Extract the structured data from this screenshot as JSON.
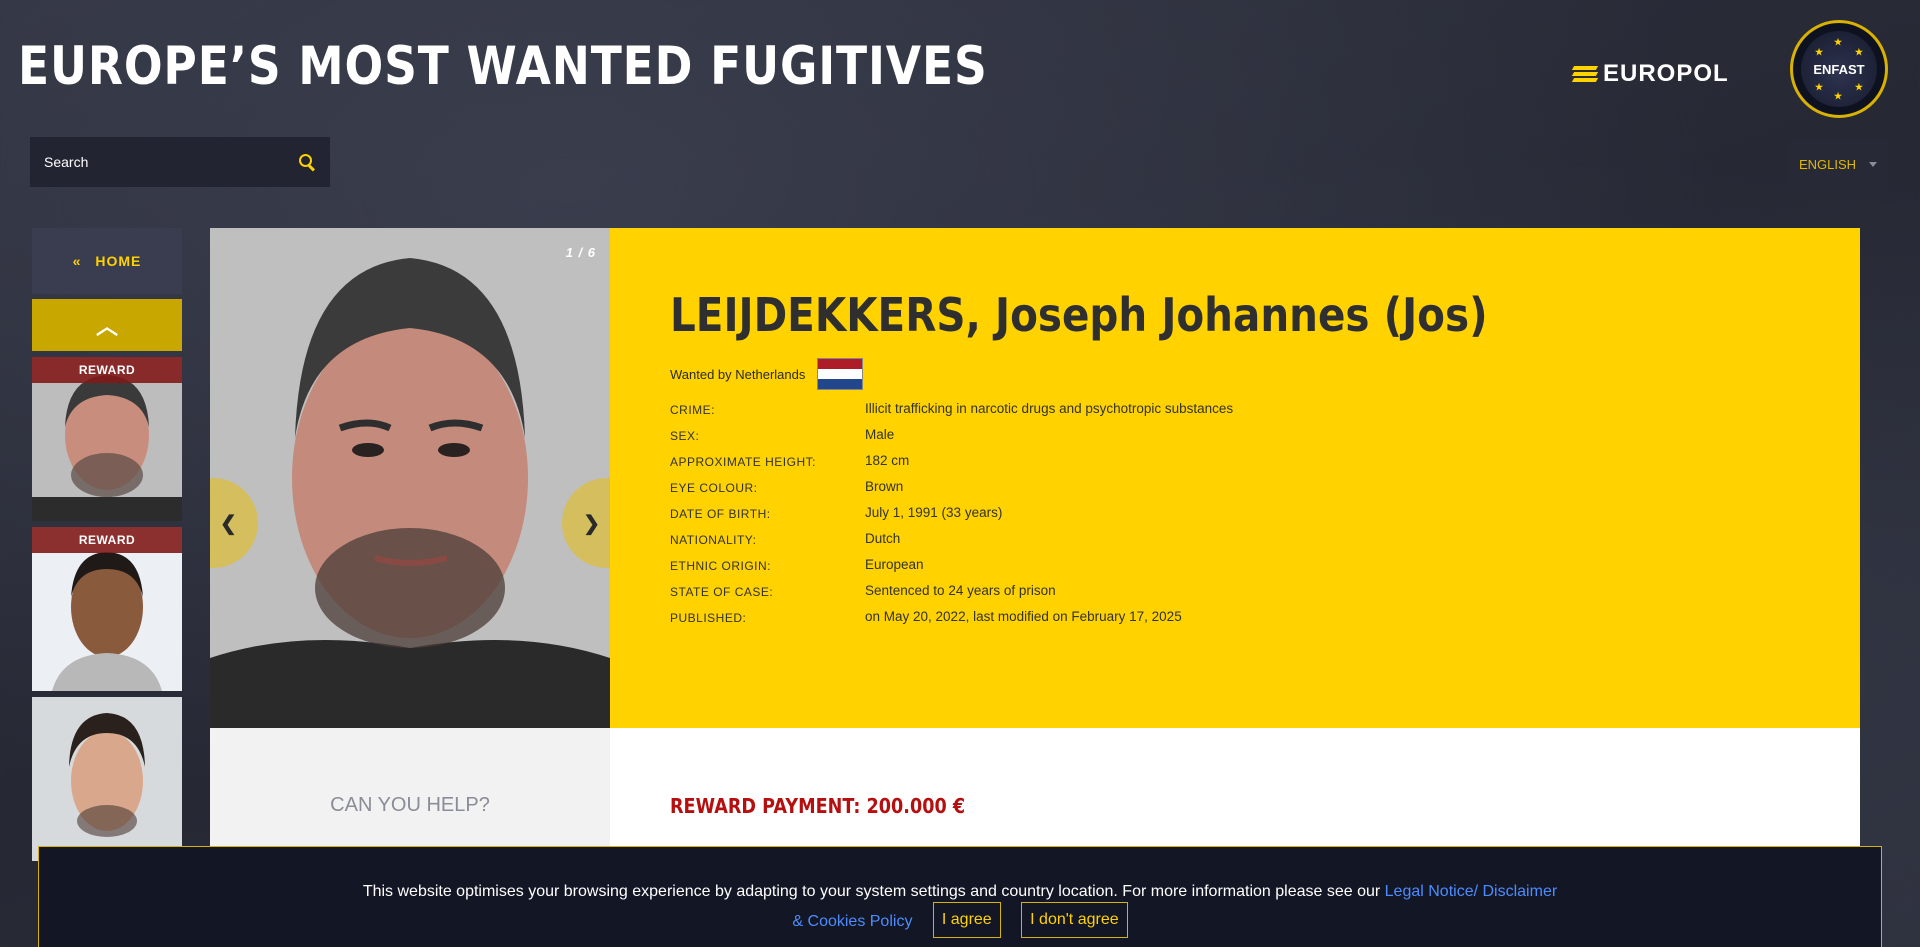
{
  "header": {
    "title": "EUROPE’S MOST WANTED FUGITIVES",
    "europol_logo_text": "EUROPOL",
    "enfast_logo_text": "ENFAST"
  },
  "search": {
    "placeholder": "Search"
  },
  "language": {
    "selected": "ENGLISH"
  },
  "sidebar": {
    "home_label": "HOME",
    "home_icon": "«",
    "up_icon": "︿",
    "thumbs": [
      {
        "tag": "REWARD"
      },
      {
        "tag": "REWARD"
      },
      {
        "tag": ""
      }
    ]
  },
  "gallery": {
    "counter": "1 / 6",
    "prev_icon": "❮",
    "next_icon": "❯"
  },
  "fugitive": {
    "name": "LEIJDEKKERS, Joseph Johannes (Jos)",
    "wanted_by": "Wanted by Netherlands",
    "details": [
      {
        "label": "CRIME:",
        "value": "Illicit trafficking in narcotic drugs and psychotropic substances"
      },
      {
        "label": "SEX:",
        "value": "Male"
      },
      {
        "label": "APPROXIMATE HEIGHT:",
        "value": "182 cm"
      },
      {
        "label": "EYE COLOUR:",
        "value": "Brown"
      },
      {
        "label": "DATE OF BIRTH:",
        "value": "July 1, 1991 (33 years)"
      },
      {
        "label": "NATIONALITY:",
        "value": "Dutch"
      },
      {
        "label": "ETHNIC ORIGIN:",
        "value": "European"
      },
      {
        "label": "STATE OF CASE:",
        "value": "Sentenced to 24 years of prison"
      },
      {
        "label": "PUBLISHED:",
        "value": "on May 20, 2022, last modified on February 17, 2025"
      }
    ]
  },
  "help": {
    "title": "CAN YOU HELP?"
  },
  "reward": {
    "text": "REWARD PAYMENT: 200.000 €"
  },
  "cookie": {
    "text": "This website optimises your browsing experience by adapting to your system settings and country location. For more information please see our",
    "link": "Legal Notice/ Disclaimer & Cookies Policy",
    "agree": "I agree",
    "disagree": "I don't agree"
  },
  "colors": {
    "accent": "#ffd200",
    "reward_red": "#b50f0f",
    "background": "#2a2d3a"
  }
}
